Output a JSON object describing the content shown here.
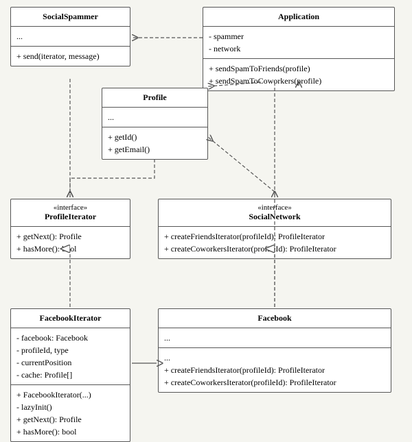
{
  "boxes": {
    "socialSpammer": {
      "title": "SocialSpammer",
      "stereotype": null,
      "sections": [
        [
          "..."
        ],
        [
          "+ send(iterator, message)"
        ]
      ]
    },
    "application": {
      "title": "Application",
      "stereotype": null,
      "sections": [
        [
          "- spammer",
          "- network"
        ],
        [
          "+ sendSpamToFriends(profile)",
          "+ sendSpamToCoworkers(profile)"
        ]
      ]
    },
    "profile": {
      "title": "Profile",
      "stereotype": null,
      "sections": [
        [
          "..."
        ],
        [
          "+ getId()",
          "+ getEmail()"
        ]
      ]
    },
    "profileIterator": {
      "title": "ProfileIterator",
      "stereotype": "«interface»",
      "sections": [
        [
          "+ getNext(): Profile",
          "+ hasMore(): bool"
        ]
      ]
    },
    "socialNetwork": {
      "title": "SocialNetwork",
      "stereotype": "«interface»",
      "sections": [
        [
          "+ createFriendsIterator(profileId): ProfileIterator",
          "+ createCoworkersIterator(profileId): ProfileIterator"
        ]
      ]
    },
    "facebookIterator": {
      "title": "FacebookIterator",
      "stereotype": null,
      "sections": [
        [
          "- facebook: Facebook",
          "- profileId, type",
          "- currentPosition",
          "- cache: Profile[]"
        ],
        [
          "+ FacebookIterator(...)",
          "- lazyInit()",
          "+ getNext(): Profile",
          "+ hasMore(): bool"
        ]
      ]
    },
    "facebook": {
      "title": "Facebook",
      "stereotype": null,
      "sections": [
        [
          "..."
        ],
        [
          "...",
          "+ createFriendsIterator(profileId): ProfileIterator",
          "+ createCoworkersIterator(profileId): ProfileIterator"
        ]
      ]
    }
  }
}
